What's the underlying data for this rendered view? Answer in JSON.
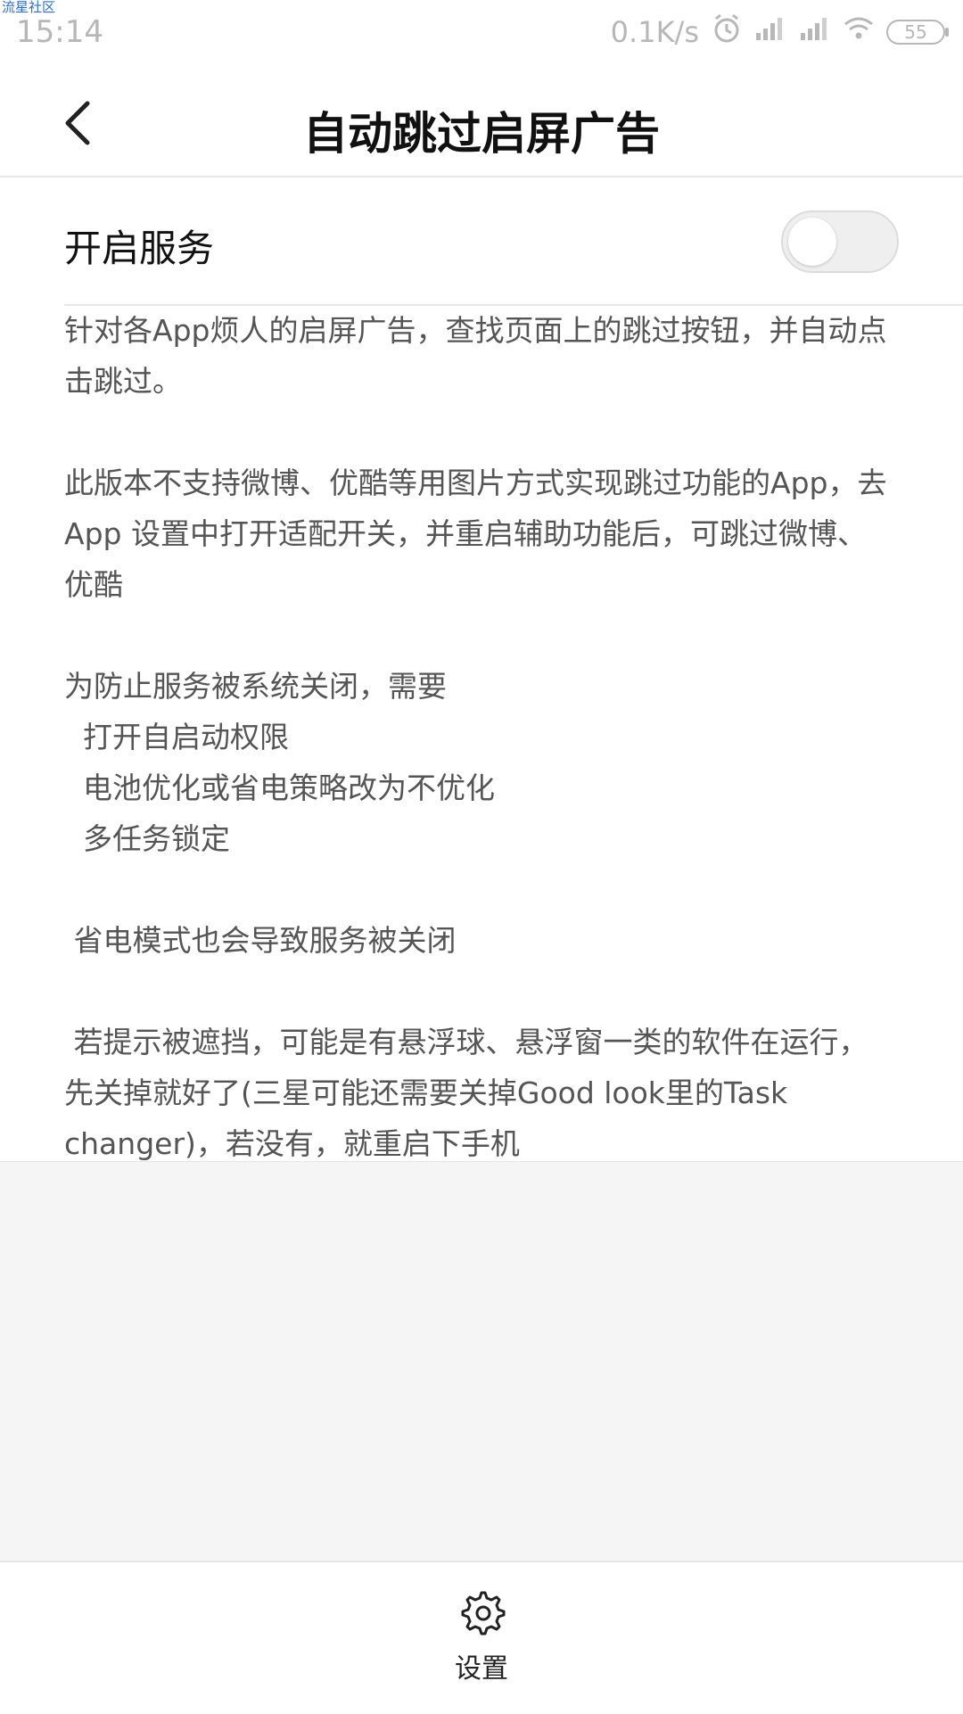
{
  "watermark": "流星社区",
  "status_bar": {
    "time": "15:14",
    "net_speed": "0.1K/s",
    "battery": "55"
  },
  "header": {
    "title": "自动跳过启屏广告"
  },
  "service_row": {
    "label": "开启服务",
    "toggle_on": false
  },
  "content": {
    "lines": [
      "针对各App烦人的启屏广告，查找页面上的跳过按钮，并自动点击跳过。",
      "",
      "此版本不支持微博、优酷等用图片方式实现跳过功能的App，去App 设置中打开适配开关，并重启辅助功能后，可跳过微博、优酷",
      "",
      "为防止服务被系统关闭，需要",
      "  打开自启动权限",
      "  电池优化或省电策略改为不优化",
      "  多任务锁定",
      "",
      " 省电模式也会导致服务被关闭",
      "",
      " 若提示被遮挡，可能是有悬浮球、悬浮窗一类的软件在运行，先关掉就好了(三星可能还需要关掉Good look里的Task changer)，若没有，就重启下手机"
    ]
  },
  "bottom_bar": {
    "settings_label": "设置"
  }
}
